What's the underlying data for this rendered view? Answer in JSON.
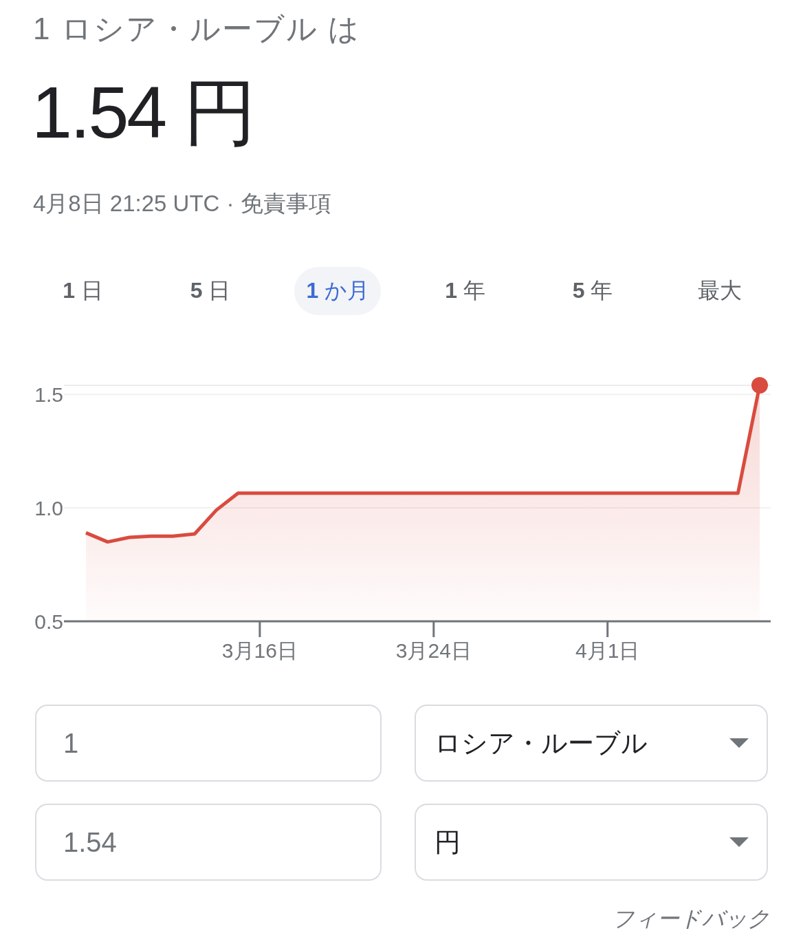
{
  "conversion": {
    "heading": "1 ロシア・ルーブル は",
    "result": "1.54 円",
    "timestamp": "4月8日 21:25 UTC",
    "separator": "·",
    "disclaimer": "免責事項"
  },
  "range_tabs": [
    {
      "label": "**1** 日",
      "selected": false
    },
    {
      "label": "**5** 日",
      "selected": false
    },
    {
      "label": "**1** か月",
      "selected": true
    },
    {
      "label": "**1** 年",
      "selected": false
    },
    {
      "label": "**5** 年",
      "selected": false
    },
    {
      "label": "最大",
      "selected": false
    }
  ],
  "chart": {
    "chart_data": {
      "type": "area",
      "categories": [
        null,
        null,
        null,
        null,
        null,
        null,
        null,
        null,
        "3月16日",
        null,
        null,
        null,
        null,
        null,
        null,
        null,
        "3月24日",
        null,
        null,
        null,
        null,
        null,
        null,
        null,
        "4月1日",
        null,
        null,
        null,
        null,
        null,
        null,
        null
      ],
      "series": [
        {
          "color": "#d94b3f",
          "values": [
            0.89,
            0.85,
            0.87,
            0.875,
            0.875,
            0.885,
            0.99,
            1.065,
            1.065,
            1.065,
            1.065,
            1.065,
            1.065,
            1.065,
            1.065,
            1.065,
            1.065,
            1.065,
            1.065,
            1.065,
            1.065,
            1.065,
            1.065,
            1.065,
            1.065,
            1.065,
            1.065,
            1.065,
            1.065,
            1.065,
            1.065,
            1.54
          ]
        }
      ],
      "ylim": [
        0.5,
        1.54
      ],
      "yticks": [
        {
          "value": 0.5,
          "label": "0.5"
        },
        {
          "value": 1,
          "label": "1.0"
        },
        {
          "value": 1.5,
          "label": "1.5"
        }
      ]
    }
  },
  "converter": {
    "rows": [
      {
        "amount": "1",
        "currency": "ロシア・ルーブル"
      },
      {
        "amount": "1.54",
        "currency": "円"
      }
    ]
  },
  "feedback": "フィードバック"
}
